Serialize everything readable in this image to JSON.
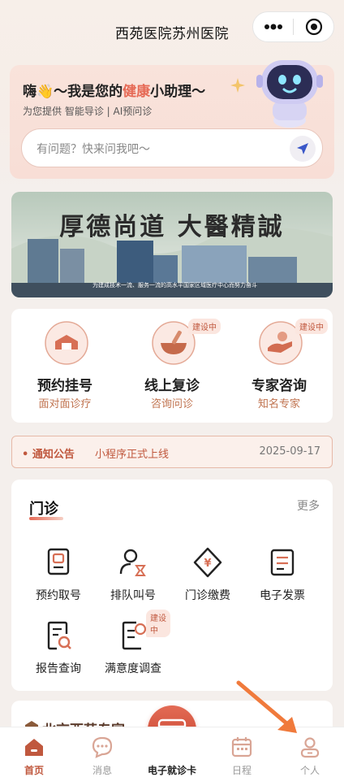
{
  "header": {
    "title": "西苑医院苏州医院"
  },
  "assistant": {
    "greeting_pre": "嗨👋～我是您的",
    "greeting_hl": "健康",
    "greeting_post": "小助理～",
    "subtitle": "为您提供  智能导诊 | AI预问诊",
    "search_placeholder": "有问题？快来问我吧～"
  },
  "banner": {
    "motto": "厚德尚道  大醫精誠",
    "caption": "为建成技术一流、服务一流的高水平国家区域医疗中心而努力奋斗"
  },
  "services": [
    {
      "title": "预约挂号",
      "subtitle": "面对面诊疗",
      "badge": ""
    },
    {
      "title": "线上复诊",
      "subtitle": "咨询问诊",
      "badge": "建设中"
    },
    {
      "title": "专家咨询",
      "subtitle": "知名专家",
      "badge": "建设中"
    }
  ],
  "notice": {
    "label": "• 通知公告",
    "content": "小程序正式上线",
    "date": "2025-09-17"
  },
  "outpatient": {
    "title": "门诊",
    "more": "更多",
    "items": [
      {
        "label": "预约取号",
        "icon": "ticket-icon",
        "badge": ""
      },
      {
        "label": "排队叫号",
        "icon": "queue-user-icon",
        "badge": ""
      },
      {
        "label": "门诊缴费",
        "icon": "yuan-payment-icon",
        "badge": ""
      },
      {
        "label": "电子发票",
        "icon": "invoice-icon",
        "badge": ""
      },
      {
        "label": "报告查询",
        "icon": "report-search-icon",
        "badge": ""
      },
      {
        "label": "满意度调查",
        "icon": "survey-icon",
        "badge": "建设中"
      }
    ]
  },
  "next_section": {
    "title": "北京西苑专家"
  },
  "tabbar": [
    {
      "label": "首页",
      "icon": "home-icon",
      "active": true
    },
    {
      "label": "消息",
      "icon": "message-icon",
      "active": false
    },
    {
      "label": "电子就诊卡",
      "icon": "card-icon",
      "active": false
    },
    {
      "label": "日程",
      "icon": "calendar-icon",
      "active": false
    },
    {
      "label": "个人",
      "icon": "person-icon",
      "active": false
    }
  ],
  "colors": {
    "accent": "#c0583e",
    "accent_light": "#e66a56",
    "arrow": "#f07a3c"
  }
}
